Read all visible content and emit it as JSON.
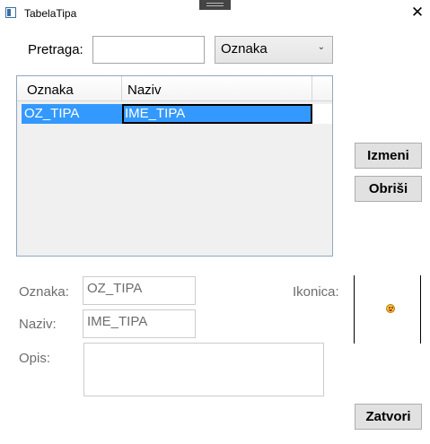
{
  "window": {
    "title": "TabelaTipa",
    "close_glyph": "✕"
  },
  "search": {
    "label": "Pretraga:",
    "value": "",
    "filter_selected": "Oznaka",
    "filter_arrow": "⌄"
  },
  "table": {
    "columns": [
      "Oznaka",
      "Naziv"
    ],
    "rows": [
      {
        "oznaka": "OZ_TIPA",
        "naziv": "IME_TIPA",
        "selected": true
      }
    ],
    "selection_color": "#3399ff"
  },
  "actions": {
    "edit_label": "Izmeni",
    "delete_label": "Obriši",
    "close_label": "Zatvori"
  },
  "details": {
    "oznaka_label": "Oznaka:",
    "oznaka_value": "OZ_TIPA",
    "naziv_label": "Naziv:",
    "naziv_value": "IME_TIPA",
    "opis_label": "Opis:",
    "opis_value": "",
    "ikonica_label": "Ikonica:",
    "icon_name": "smiley-icon"
  }
}
